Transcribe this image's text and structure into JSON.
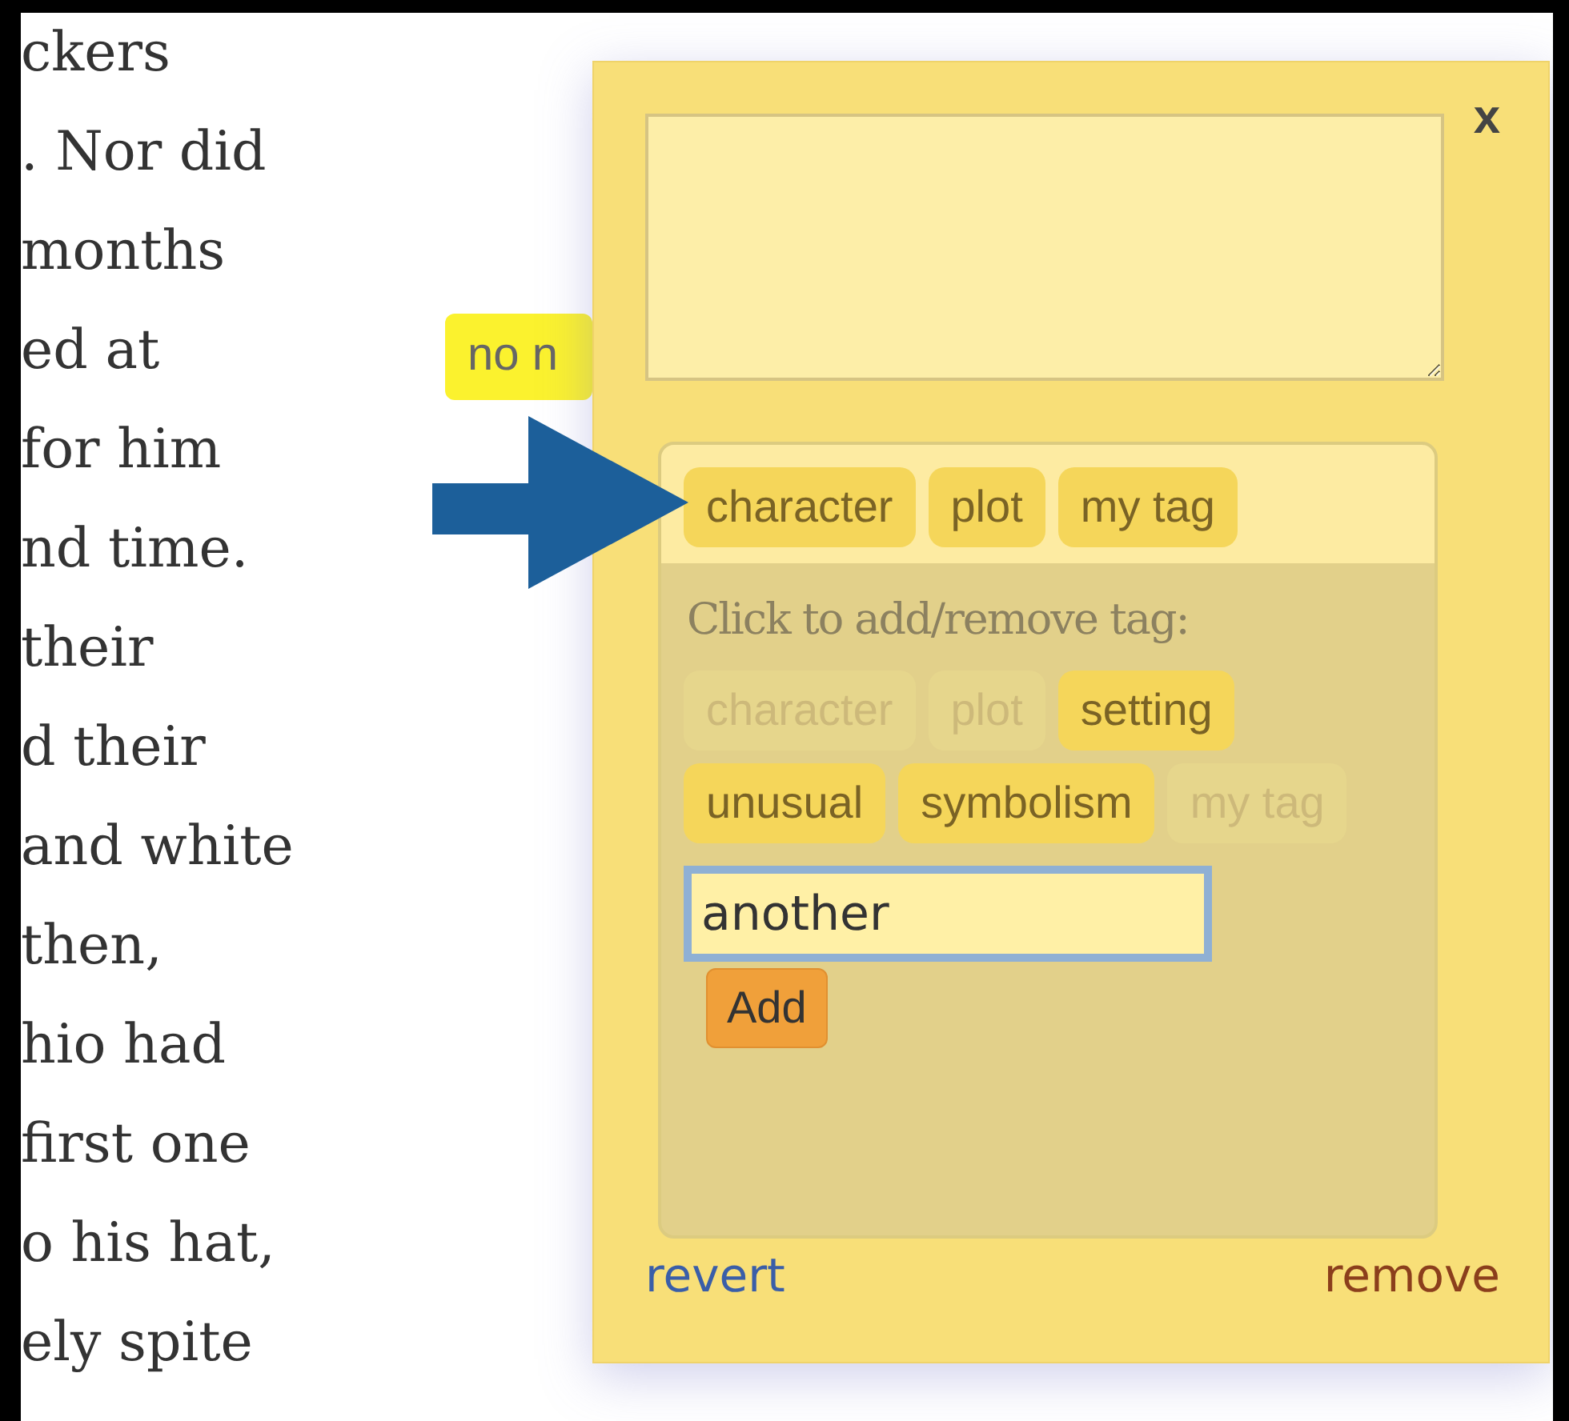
{
  "background_text": [
    "ckers",
    ". Nor did",
    "months",
    "ed at",
    "for him",
    "nd time.",
    "their",
    "d their",
    "and white",
    "then,",
    "hio had",
    "first one",
    "o his hat,",
    "ely spite"
  ],
  "highlight_label": {
    "text": "no n"
  },
  "note_popup": {
    "close": "x",
    "selected_tags": [
      {
        "label": "character"
      },
      {
        "label": "plot"
      },
      {
        "label": "my tag"
      }
    ],
    "add_prompt": "Click to add/remove tag:",
    "tag_options": [
      {
        "label": "character",
        "disabled": true
      },
      {
        "label": "plot",
        "disabled": true
      },
      {
        "label": "setting",
        "disabled": false
      },
      {
        "label": "unusual",
        "disabled": false
      },
      {
        "label": "symbolism",
        "disabled": false
      },
      {
        "label": "my tag",
        "disabled": true
      }
    ],
    "new_tag_input": {
      "value": "another"
    },
    "add_button": "Add",
    "revert_link": "revert",
    "remove_link": "remove"
  }
}
